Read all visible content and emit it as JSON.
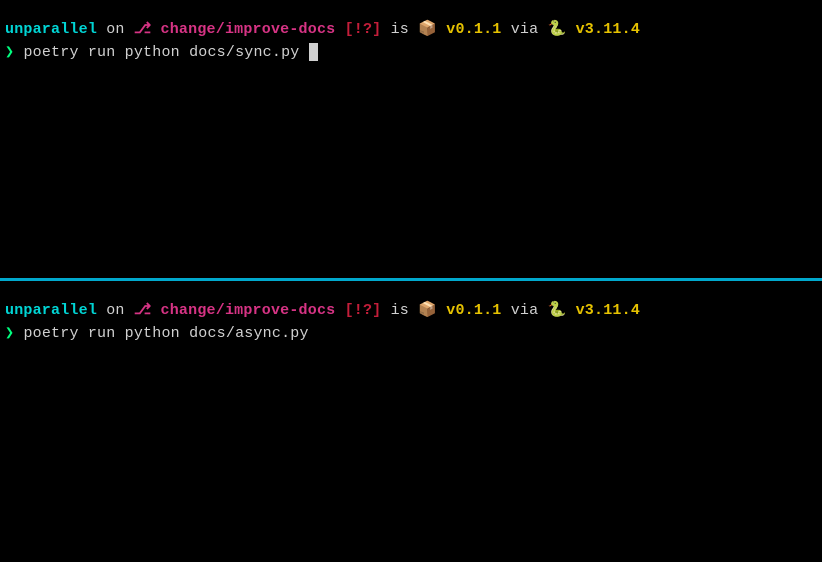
{
  "panes": {
    "top": {
      "prompt": {
        "directory": "unparallel",
        "on_label": " on ",
        "branch_icon": "⎇",
        "branch": "change/improve-docs",
        "git_status": "[!?]",
        "is_label": " is ",
        "package_icon": "📦",
        "package_version": "v0.1.1",
        "via_label": " via ",
        "python_icon": "🐍",
        "python_version": "v3.11.4"
      },
      "command": {
        "arrow": "❯",
        "text": "poetry run python docs/sync.py"
      },
      "show_cursor": true
    },
    "bottom": {
      "prompt": {
        "directory": "unparallel",
        "on_label": " on ",
        "branch_icon": "⎇",
        "branch": "change/improve-docs",
        "git_status": "[!?]",
        "is_label": " is ",
        "package_icon": "📦",
        "package_version": "v0.1.1",
        "via_label": " via ",
        "python_icon": "🐍",
        "python_version": "v3.11.4"
      },
      "command": {
        "arrow": "❯",
        "text": "poetry run python docs/async.py"
      },
      "show_cursor": false
    }
  }
}
